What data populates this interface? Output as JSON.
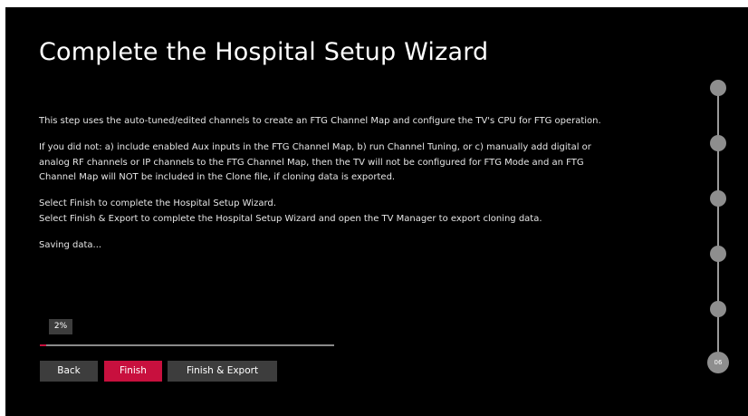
{
  "wizard": {
    "title": "Complete the Hospital Setup Wizard",
    "paragraphs": [
      "This step uses the auto-tuned/edited channels to create an FTG Channel Map and configure the TV's CPU for FTG operation.",
      "If you did not: a) include enabled Aux inputs in the FTG Channel Map, b) run Channel Tuning, or c) manually add digital or analog RF channels or IP channels to the FTG Channel Map, then the TV will not be configured for FTG Mode and an FTG Channel Map will NOT be included in the Clone file, if cloning data is exported.",
      "Select Finish to complete the Hospital Setup Wizard.",
      "Select Finish & Export to complete the Hospital Setup Wizard and open the TV Manager to export cloning data.",
      "Saving data..."
    ]
  },
  "progress": {
    "label": "2%",
    "fraction": 0.02
  },
  "buttons": {
    "back": "Back",
    "finish": "Finish",
    "finish_export": "Finish & Export"
  },
  "stepper": {
    "total_steps": 6,
    "current_step_label": "06"
  },
  "colors": {
    "background": "#000000",
    "accent": "#c8103e",
    "button": "#3d3d3d",
    "step_dot": "#8e8e8e"
  }
}
